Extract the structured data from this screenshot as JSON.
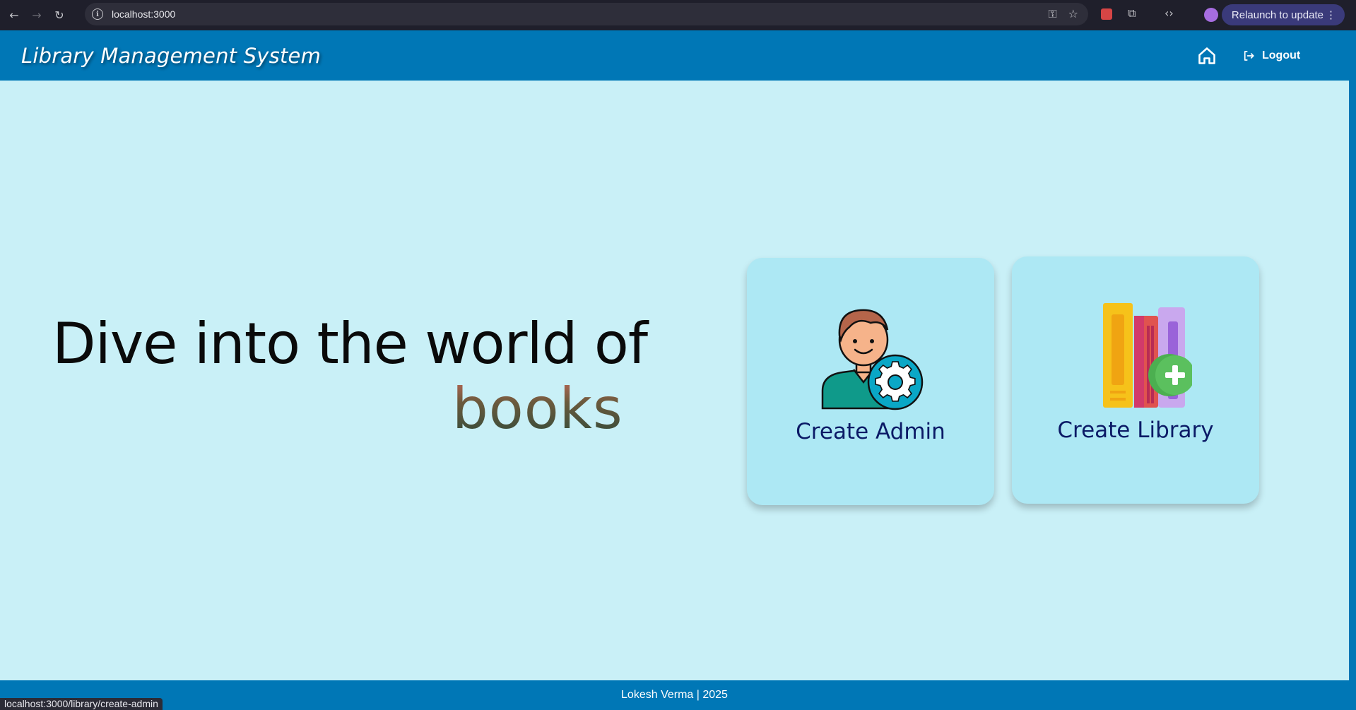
{
  "browser": {
    "url": "localhost:3000",
    "relaunch_label": "Relaunch to update",
    "status_url": "localhost:3000/library/create-admin"
  },
  "header": {
    "brand": "Library Management System",
    "logout_label": "Logout"
  },
  "hero": {
    "line1": "Dive into the world of",
    "line2": "books"
  },
  "cards": {
    "admin_label": "Create Admin",
    "library_label": "Create Library"
  },
  "footer": {
    "text": "Lokesh Verma | 2025"
  },
  "colors": {
    "header_bg": "#0077b6",
    "page_bg": "#c9f0f7",
    "card_bg": "#ade8f4",
    "card_text": "#0b1a66"
  }
}
